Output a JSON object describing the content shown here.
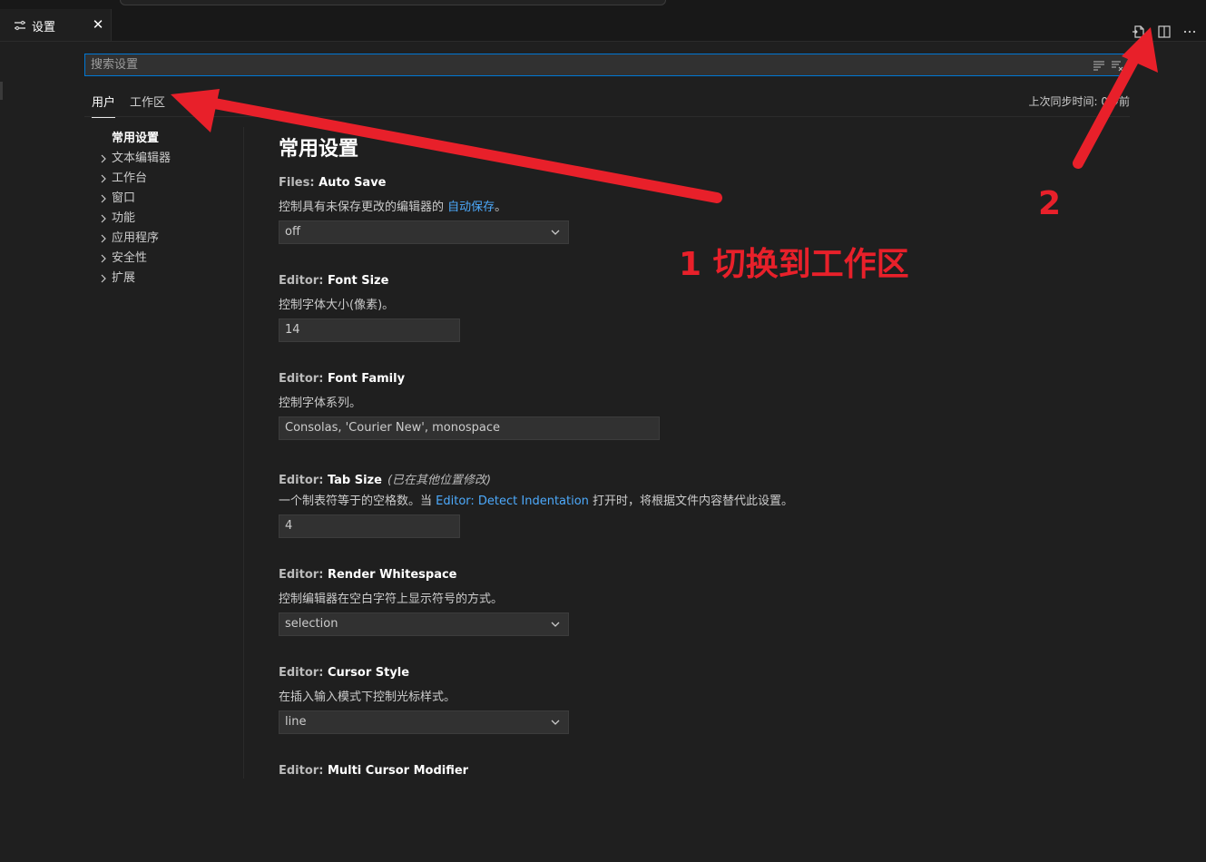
{
  "tab": {
    "label": "设置",
    "close_label": "✕"
  },
  "search": {
    "placeholder": "搜索设置"
  },
  "scopes": {
    "user": "用户",
    "workspace": "工作区",
    "sync_status": "上次同步时间: 0秒前"
  },
  "toc": [
    {
      "label": "常用设置",
      "active": true
    },
    {
      "label": "文本编辑器"
    },
    {
      "label": "工作台"
    },
    {
      "label": "窗口"
    },
    {
      "label": "功能"
    },
    {
      "label": "应用程序"
    },
    {
      "label": "安全性"
    },
    {
      "label": "扩展"
    }
  ],
  "section_title": "常用设置",
  "settings": [
    {
      "category": "Files: ",
      "name": "Auto Save",
      "desc_before": "控制具有未保存更改的编辑器的 ",
      "desc_link": "自动保存",
      "desc_after": "。",
      "value": "off"
    },
    {
      "category": "Editor: ",
      "name": "Font Size",
      "desc": "控制字体大小(像素)。",
      "value": "14"
    },
    {
      "category": "Editor: ",
      "name": "Font Family",
      "desc": "控制字体系列。",
      "value": "Consolas, 'Courier New', monospace"
    },
    {
      "category": "Editor: ",
      "name": "Tab Size",
      "modified": "(已在其他位置修改)",
      "desc_before": "一个制表符等于的空格数。当 ",
      "desc_link": "Editor: Detect Indentation",
      "desc_after": " 打开时，将根据文件内容替代此设置。",
      "value": "4"
    },
    {
      "category": "Editor: ",
      "name": "Render Whitespace",
      "desc": "控制编辑器在空白字符上显示符号的方式。",
      "value": "selection"
    },
    {
      "category": "Editor: ",
      "name": "Cursor Style",
      "desc": "在插入输入模式下控制光标样式。",
      "value": "line"
    },
    {
      "category": "Editor: ",
      "name": "Multi Cursor Modifier"
    }
  ],
  "annotations": {
    "step1": "1 切换到工作区",
    "step2": "2",
    "color": "#e8202a"
  },
  "colors": {
    "accent": "#0078d4",
    "link": "#4daafc",
    "background": "#1f1f1f"
  }
}
